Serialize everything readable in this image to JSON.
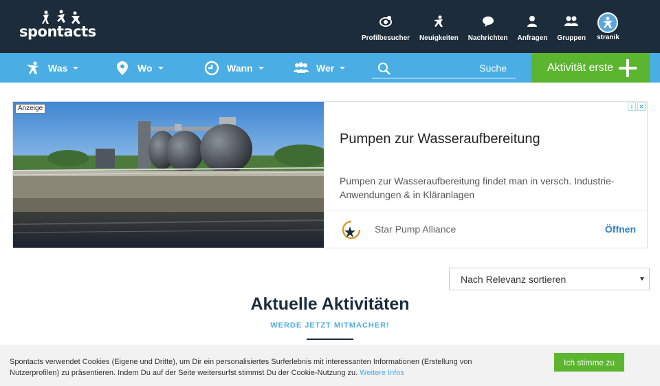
{
  "header": {
    "logo_text": "spontacts",
    "nav": [
      {
        "label": "Profilbesucher",
        "icon": "eye-badge-icon"
      },
      {
        "label": "Neuigkeiten",
        "icon": "activity-icon"
      },
      {
        "label": "Nachrichten",
        "icon": "chat-icon"
      },
      {
        "label": "Anfragen",
        "icon": "user-icon"
      },
      {
        "label": "Gruppen",
        "icon": "group-icon"
      }
    ],
    "user_label": "stranik"
  },
  "searchbar": {
    "filters": [
      {
        "label": "Was",
        "icon": "person-icon"
      },
      {
        "label": "Wo",
        "icon": "location-pin-icon"
      },
      {
        "label": "Wann",
        "icon": "clock-icon"
      },
      {
        "label": "Wer",
        "icon": "group-icon"
      }
    ],
    "search_placeholder": "Suche",
    "create_label": "Aktivität erste"
  },
  "ad": {
    "badge": "Anzeige",
    "title": "Pumpen zur Wasseraufbereitung",
    "description": "Pumpen zur Wasseraufbereitung findet man in versch. Industrie-Anwendungen & in Kläranlagen",
    "advertiser": "Star Pump Alliance",
    "open_label": "Öffnen"
  },
  "sort": {
    "selected": "Nach Relevanz sortieren"
  },
  "section": {
    "title": "Aktuelle Aktivitäten",
    "subtitle": "WERDE JETZT MITMACHER!"
  },
  "cookie": {
    "text": "Spontacts verwendet Cookies (Eigene und Dritte), um Dir ein personalisiertes Surferlebnis mit interessanten Informationen (Erstellung von Nutzerprofilen) zu präsentieren. Indem Du auf der Seite weitersurfst stimmst Du der Cookie-Nutzung zu.",
    "more_label": "Weitere Infos",
    "accept_label": "Ich stimme zu"
  },
  "colors": {
    "header_bg": "#1c2c3b",
    "bar_bg": "#4aaee4",
    "accent_green": "#5cb52f",
    "link_blue": "#2b7fc1"
  }
}
